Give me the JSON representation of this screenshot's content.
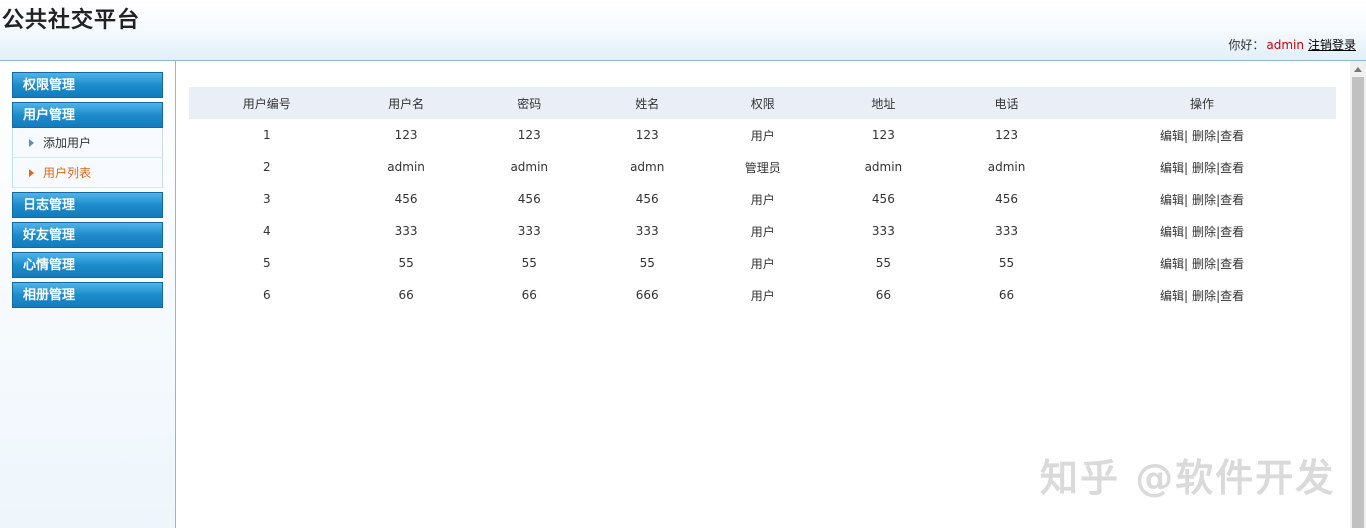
{
  "header": {
    "title": "公共社交平台",
    "greeting": "你好：",
    "username": "admin",
    "logout_label": "注销登录"
  },
  "sidebar": {
    "groups": [
      {
        "label": "权限管理"
      },
      {
        "label": "用户管理",
        "items": [
          {
            "label": "添加用户"
          },
          {
            "label": "用户列表"
          }
        ]
      },
      {
        "label": "日志管理"
      },
      {
        "label": "好友管理"
      },
      {
        "label": "心情管理"
      },
      {
        "label": "相册管理"
      }
    ]
  },
  "table": {
    "columns": [
      "用户编号",
      "用户名",
      "密码",
      "姓名",
      "权限",
      "地址",
      "电话",
      "操作"
    ],
    "rows": [
      [
        "1",
        "123",
        "123",
        "123",
        "用户",
        "123",
        "123"
      ],
      [
        "2",
        "admin",
        "admin",
        "admn",
        "管理员",
        "admin",
        "admin"
      ],
      [
        "3",
        "456",
        "456",
        "456",
        "用户",
        "456",
        "456"
      ],
      [
        "4",
        "333",
        "333",
        "333",
        "用户",
        "333",
        "333"
      ],
      [
        "5",
        "55",
        "55",
        "55",
        "用户",
        "55",
        "55"
      ],
      [
        "6",
        "66",
        "66",
        "666",
        "用户",
        "66",
        "66"
      ]
    ],
    "actions": {
      "edit": "编辑",
      "sep": "|",
      "delete": "删除",
      "view": "查看"
    }
  },
  "watermark": "知乎 @软件开发",
  "colors": {
    "accent": "#1e8ccb",
    "active_item": "#e0661a",
    "username": "#d40000",
    "header_row": "#eaeff7"
  }
}
